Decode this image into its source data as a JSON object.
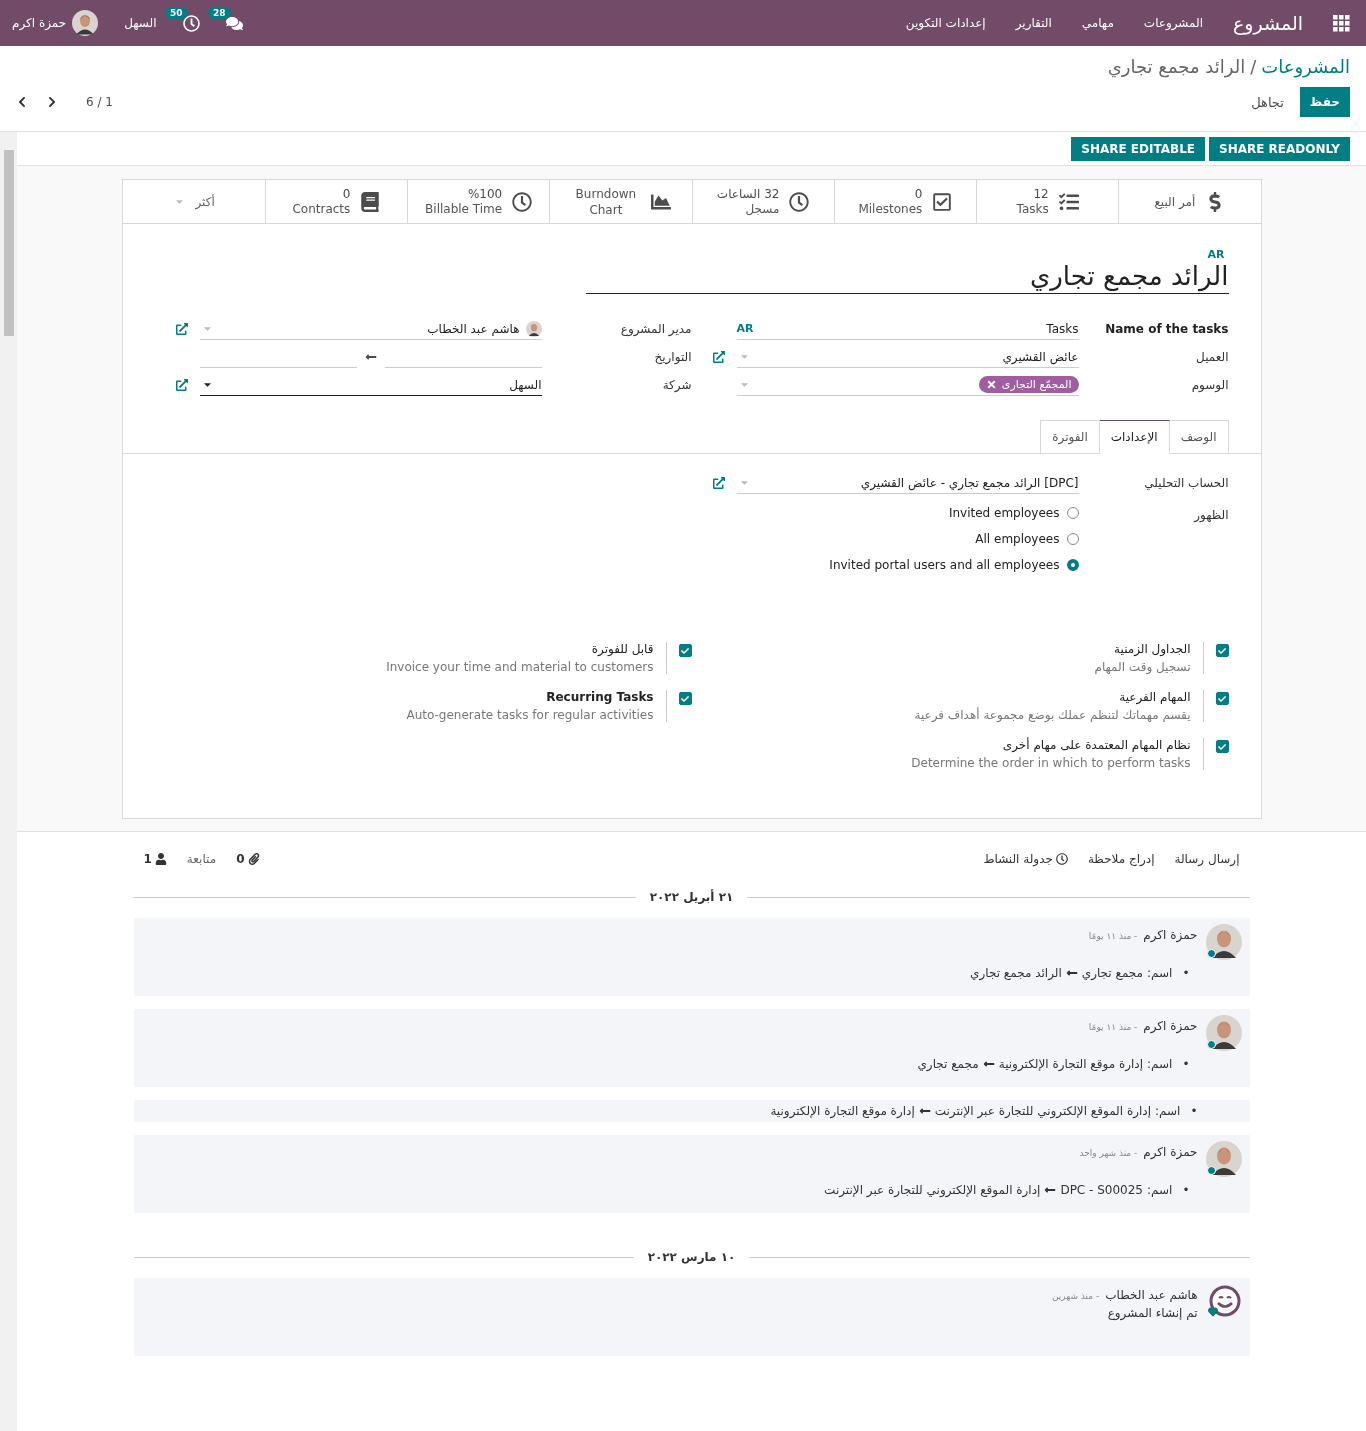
{
  "navbar": {
    "app": "المشروع",
    "menus": [
      "المشروعات",
      "مهامي",
      "التقارير",
      "إعدادات التكوين"
    ],
    "messages_count": "28",
    "activities_count": "50",
    "company": "السهل",
    "user": "حمزة اكرم"
  },
  "breadcrumb": {
    "parent": "المشروعات",
    "separator": "/",
    "current": "الرائد مجمع تجاري"
  },
  "actions": {
    "save": "حفظ",
    "discard": "تجاهل"
  },
  "pager": "1 / 6",
  "header_buttons": [
    "SHARE READONLY",
    "SHARE EDITABLE"
  ],
  "stat_buttons": [
    {
      "kind": "sales",
      "label": "أمر البيع"
    },
    {
      "kind": "tasks",
      "value": "12",
      "label": "Tasks"
    },
    {
      "kind": "milestones",
      "value": "0",
      "label": "Milestones"
    },
    {
      "kind": "timesheet",
      "value": "32 الساعات",
      "label": "مسجل"
    },
    {
      "kind": "burndown",
      "label": "Burndown Chart"
    },
    {
      "kind": "billable",
      "value": "%100",
      "label": "Billable Time"
    },
    {
      "kind": "contracts",
      "value": "0",
      "label": "Contracts"
    },
    {
      "kind": "more",
      "label": "أكثر"
    }
  ],
  "title": {
    "language": "AR",
    "value": "الرائد مجمع تجاري"
  },
  "fields_right": [
    {
      "kind": "translatable",
      "label": "Name of the tasks",
      "value": "Tasks",
      "language": "AR"
    },
    {
      "kind": "many2one",
      "label": "العميل",
      "value": "عائض القشيري"
    },
    {
      "kind": "tags",
      "label": "الوسوم",
      "tags": [
        "المجمّع التجارى"
      ]
    }
  ],
  "fields_left": [
    {
      "kind": "user",
      "label": "مدير المشروع",
      "value": "هاشم عبد الخطاب"
    },
    {
      "kind": "daterange",
      "label": "التواريخ"
    },
    {
      "kind": "select",
      "label": "شركة",
      "value": "السهل"
    }
  ],
  "tabs": [
    {
      "label": "الوصف",
      "selected": false
    },
    {
      "label": "الإعدادات",
      "selected": true
    },
    {
      "label": "الفوترة",
      "selected": false
    }
  ],
  "analytic_account": {
    "label": "الحساب التحليلي",
    "value": "[DPC] الرائد مجمع تجاري - عائض القشيري"
  },
  "visibility": {
    "label": "الظهور",
    "options": [
      {
        "label": "Invited employees",
        "selected": false
      },
      {
        "label": "All employees",
        "selected": false
      },
      {
        "label": "Invited portal users and all employees",
        "selected": true
      }
    ]
  },
  "features": [
    {
      "title": "الجداول الزمنية",
      "description": "تسجيل وقت المهام",
      "checked": true
    },
    {
      "title": "قابل للفوترة",
      "description": "Invoice your time and material to customers",
      "checked": true
    },
    {
      "title": "المهام الفرعية",
      "description": "يقسم مهماتك لتنظم عملك بوضع مجموعة أهداف فرعية",
      "checked": true
    },
    {
      "title": "Recurring Tasks",
      "description": "Auto-generate tasks for regular activities",
      "checked": true
    },
    {
      "title": "نظام المهام المعتمدة على مهام أخرى",
      "description": "Determine the order in which to perform tasks",
      "checked": true
    }
  ],
  "chatter": {
    "send_message": "إرسال رسالة",
    "log_note": "إدراج ملاحظة",
    "schedule_activity": "جدولة النشاط",
    "attachments": "0",
    "follow": "متابعة",
    "followers": "1"
  },
  "timeline": [
    {
      "kind": "date",
      "text": "٢١ أبريل ٢٠٢٢"
    },
    {
      "kind": "message",
      "online": true,
      "author": "حمزة اكرم",
      "time": "- منذ ١١ يومًا",
      "changes": [
        {
          "bullet": "•",
          "field": "اسم:",
          "old": "مجمع تجاري",
          "new": "الرائد مجمع تجاري"
        }
      ]
    },
    {
      "kind": "message",
      "online": true,
      "author": "حمزة اكرم",
      "time": "- منذ ١١ يومًا",
      "changes": [
        {
          "bullet": "•",
          "field": "اسم:",
          "old": "إدارة موقع التجارة الإلكترونية",
          "new": "مجمع تجاري"
        }
      ]
    },
    {
      "kind": "fragment",
      "changes": [
        {
          "bullet": "•",
          "field": "اسم:",
          "old": "إدارة الموقع الإلكتروني للتجارة عبر الإنترنت",
          "new": "إدارة موقع التجارة الإلكترونية"
        }
      ]
    },
    {
      "kind": "message",
      "online": true,
      "author": "حمزة اكرم",
      "time": "- منذ شهر واحد",
      "changes": [
        {
          "bullet": "•",
          "field": "اسم:",
          "old": "DPC - S00025",
          "new": "إدارة الموقع الإلكتروني للتجارة عبر الإنترنت"
        }
      ]
    },
    {
      "kind": "date",
      "text": "١٠ مارس ٢٠٢٢"
    },
    {
      "kind": "system_note",
      "author": "هاشم عبد الخطاب",
      "time": "- منذ شهرين",
      "body": "تم إنشاء المشروع"
    }
  ]
}
